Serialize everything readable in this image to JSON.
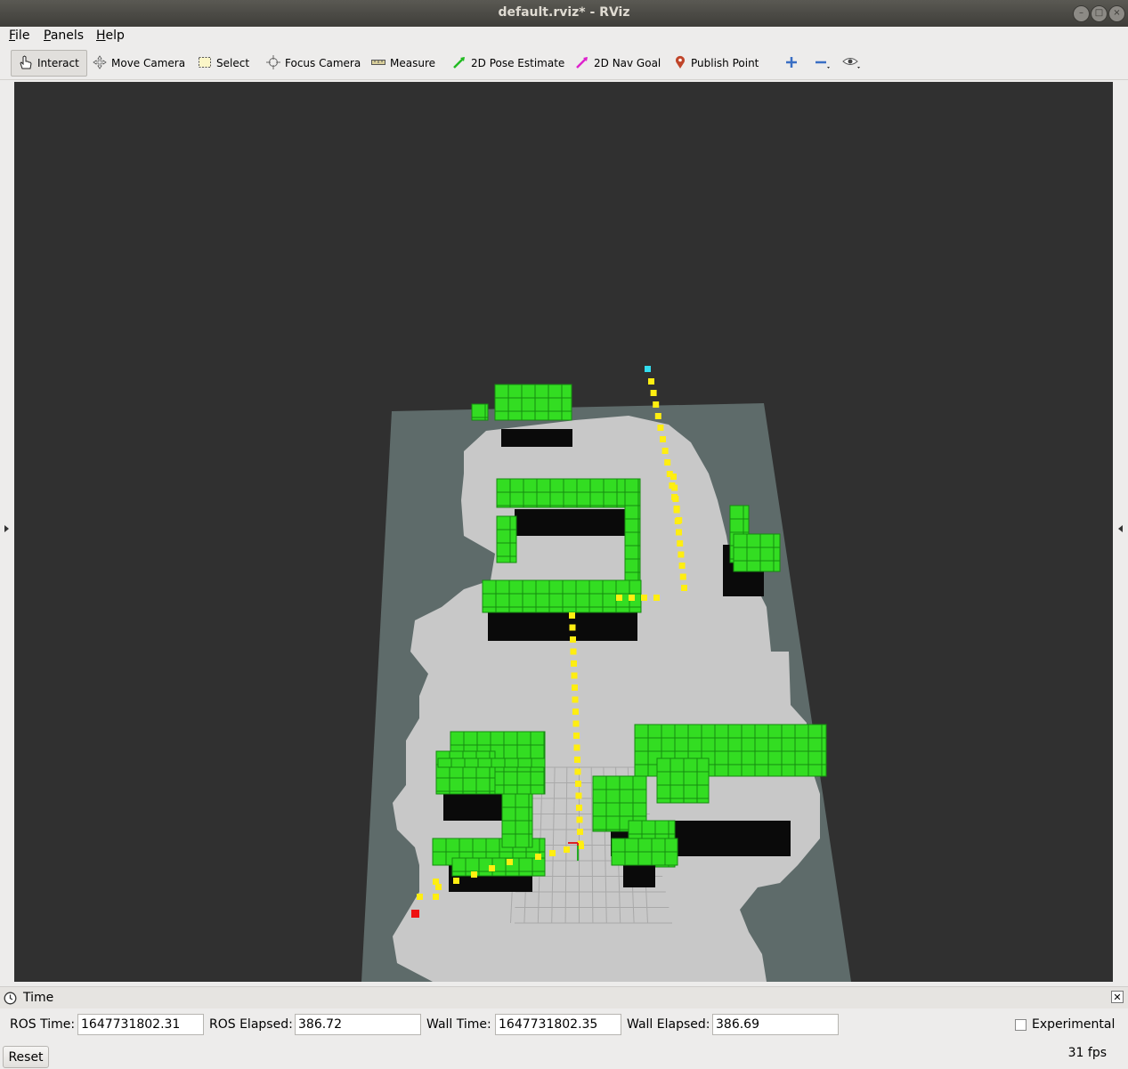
{
  "window": {
    "title": "default.rviz* - RViz"
  },
  "menu": {
    "items": [
      {
        "accel": "F",
        "rest": "ile"
      },
      {
        "accel": "P",
        "rest": "anels"
      },
      {
        "accel": "H",
        "rest": "elp"
      }
    ]
  },
  "toolbar": {
    "interact": "Interact",
    "move_camera": "Move Camera",
    "select": "Select",
    "focus_camera": "Focus Camera",
    "measure": "Measure",
    "pose_estimate": "2D Pose Estimate",
    "nav_goal": "2D Nav Goal",
    "publish_point": "Publish Point"
  },
  "scene": {
    "background": "#303030",
    "map_unknown_color": "#5e6b6a",
    "map_free_color": "#c8c8c8",
    "obstacle_color": "#33dd22",
    "shadow_color": "#0a0a0a",
    "path_color": "#ffee11",
    "goal_marker_color": "#33ddee",
    "start_marker_color": "#ee1111"
  },
  "time_panel": {
    "title": "Time",
    "ros_time_label": "ROS Time:",
    "ros_time": "1647731802.31",
    "ros_elapsed_label": "ROS Elapsed:",
    "ros_elapsed": "386.72",
    "wall_time_label": "Wall Time:",
    "wall_time": "1647731802.35",
    "wall_elapsed_label": "Wall Elapsed:",
    "wall_elapsed": "386.69",
    "experimental_label": "Experimental",
    "experimental_checked": false,
    "reset_label": "Reset",
    "fps": "31 fps"
  }
}
